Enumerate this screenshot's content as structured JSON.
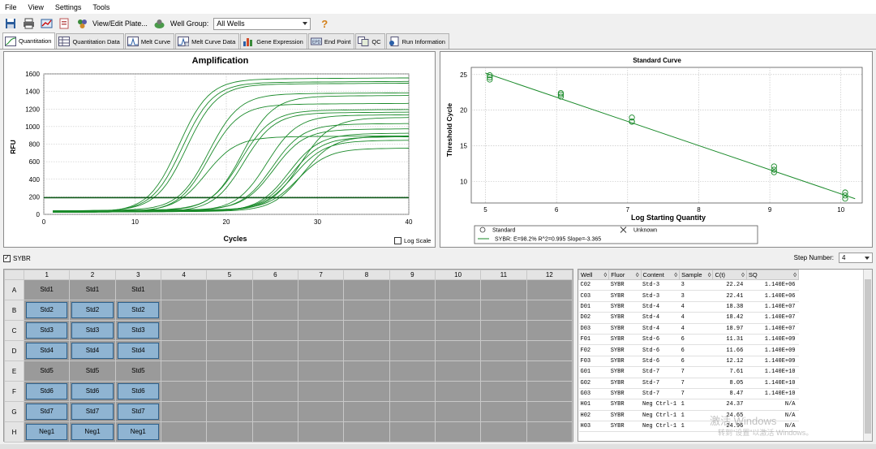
{
  "menu": [
    "File",
    "View",
    "Settings",
    "Tools"
  ],
  "toolbar": {
    "view_edit_plate": "View/Edit Plate...",
    "well_group_label": "Well Group:",
    "well_group_value": "All Wells",
    "help_icon": "help-icon"
  },
  "tabs": [
    "Quantitation",
    "Quantitation Data",
    "Melt Curve",
    "Melt Curve Data",
    "Gene Expression",
    "End Point",
    "QC",
    "Run Information"
  ],
  "amplification": {
    "title": "Amplification",
    "xlabel": "Cycles",
    "ylabel": "RFU",
    "log_scale_label": "Log Scale"
  },
  "standard_curve": {
    "title": "Standard Curve",
    "xlabel": "Log Starting Quantity",
    "ylabel": "Threshold Cycle",
    "legend_standard": "Standard",
    "legend_unknown": "Unknown",
    "legend_fit": "SYBR: E=98.2% R^2=0.995 Slope=-3.365"
  },
  "fluor_checkbox": "SYBR",
  "step_number": {
    "label": "Step Number:",
    "value": "4"
  },
  "plate": {
    "columns": [
      "1",
      "2",
      "3",
      "4",
      "5",
      "6",
      "7",
      "8",
      "9",
      "10",
      "11",
      "12"
    ],
    "rows": [
      {
        "row": "A",
        "wells": [
          "Std1",
          "Std1",
          "Std1"
        ],
        "selected": false
      },
      {
        "row": "B",
        "wells": [
          "Std2",
          "Std2",
          "Std2"
        ],
        "selected": true
      },
      {
        "row": "C",
        "wells": [
          "Std3",
          "Std3",
          "Std3"
        ],
        "selected": true
      },
      {
        "row": "D",
        "wells": [
          "Std4",
          "Std4",
          "Std4"
        ],
        "selected": true
      },
      {
        "row": "E",
        "wells": [
          "Std5",
          "Std5",
          "Std5"
        ],
        "selected": false
      },
      {
        "row": "F",
        "wells": [
          "Std6",
          "Std6",
          "Std6"
        ],
        "selected": true
      },
      {
        "row": "G",
        "wells": [
          "Std7",
          "Std7",
          "Std7"
        ],
        "selected": true
      },
      {
        "row": "H",
        "wells": [
          "Neg1",
          "Neg1",
          "Neg1"
        ],
        "selected": true
      }
    ]
  },
  "data_table": {
    "headers": [
      "Well",
      "Fluor",
      "Content",
      "Sample",
      "C(t)",
      "SQ"
    ],
    "rows": [
      [
        "C02",
        "SYBR",
        "Std-3",
        "3",
        "22.24",
        "1.140E+06"
      ],
      [
        "C03",
        "SYBR",
        "Std-3",
        "3",
        "22.41",
        "1.140E+06"
      ],
      [
        "D01",
        "SYBR",
        "Std-4",
        "4",
        "18.38",
        "1.140E+07"
      ],
      [
        "D02",
        "SYBR",
        "Std-4",
        "4",
        "18.42",
        "1.140E+07"
      ],
      [
        "D03",
        "SYBR",
        "Std-4",
        "4",
        "18.97",
        "1.140E+07"
      ],
      [
        "F01",
        "SYBR",
        "Std-6",
        "6",
        "11.31",
        "1.140E+09"
      ],
      [
        "F02",
        "SYBR",
        "Std-6",
        "6",
        "11.66",
        "1.140E+09"
      ],
      [
        "F03",
        "SYBR",
        "Std-6",
        "6",
        "12.12",
        "1.140E+09"
      ],
      [
        "G01",
        "SYBR",
        "Std-7",
        "7",
        "7.61",
        "1.140E+10"
      ],
      [
        "G02",
        "SYBR",
        "Std-7",
        "7",
        "8.05",
        "1.140E+10"
      ],
      [
        "G03",
        "SYBR",
        "Std-7",
        "7",
        "8.47",
        "1.140E+10"
      ],
      [
        "H01",
        "SYBR",
        "Neg Ctrl-1",
        "1",
        "24.37",
        "N/A"
      ],
      [
        "H02",
        "SYBR",
        "Neg Ctrl-1",
        "1",
        "24.65",
        "N/A"
      ],
      [
        "H03",
        "SYBR",
        "Neg Ctrl-1",
        "1",
        "24.96",
        "N/A"
      ]
    ]
  },
  "watermark": {
    "line1": "激活 Windows",
    "line2": "转到\"设置\"以激活 Windows。"
  },
  "chart_data": [
    {
      "type": "line",
      "title": "Amplification",
      "xlabel": "Cycles",
      "ylabel": "RFU",
      "xlim": [
        0,
        40
      ],
      "ylim": [
        0,
        1600
      ],
      "xticks": [
        0,
        10,
        20,
        30,
        40
      ],
      "yticks": [
        0,
        200,
        400,
        600,
        800,
        1000,
        1200,
        1400,
        1600
      ],
      "threshold": 190,
      "grid": true,
      "line_color": "#1a8a2a",
      "series": [
        {
          "ct": 11.3,
          "plateau": 1530
        },
        {
          "ct": 11.7,
          "plateau": 1490
        },
        {
          "ct": 12.1,
          "plateau": 1470
        },
        {
          "ct": 14.6,
          "plateau": 1360
        },
        {
          "ct": 15.0,
          "plateau": 1240
        },
        {
          "ct": 15.3,
          "plateau": 870
        },
        {
          "ct": 18.4,
          "plateau": 1330
        },
        {
          "ct": 18.4,
          "plateau": 1170
        },
        {
          "ct": 19.0,
          "plateau": 1140
        },
        {
          "ct": 21.5,
          "plateau": 1110
        },
        {
          "ct": 22.2,
          "plateau": 1010
        },
        {
          "ct": 22.4,
          "plateau": 950
        },
        {
          "ct": 24.4,
          "plateau": 900
        },
        {
          "ct": 24.7,
          "plateau": 860
        },
        {
          "ct": 25.0,
          "plateau": 820
        },
        {
          "ct": 25.6,
          "plateau": 730
        },
        {
          "ct": 26.0,
          "plateau": 870
        },
        {
          "ct": 25.2,
          "plateau": 1080
        }
      ]
    },
    {
      "type": "scatter",
      "title": "Standard Curve",
      "xlabel": "Log Starting Quantity",
      "ylabel": "Threshold Cycle",
      "xlim": [
        4.8,
        10.3
      ],
      "ylim": [
        7,
        26
      ],
      "xticks": [
        5,
        6,
        7,
        8,
        9,
        10
      ],
      "yticks": [
        10,
        15,
        20,
        25
      ],
      "grid": true,
      "points": [
        {
          "x": 5.06,
          "y": 24.9
        },
        {
          "x": 5.06,
          "y": 24.6
        },
        {
          "x": 5.06,
          "y": 24.3
        },
        {
          "x": 6.06,
          "y": 22.4
        },
        {
          "x": 6.06,
          "y": 22.2
        },
        {
          "x": 6.06,
          "y": 21.9
        },
        {
          "x": 7.06,
          "y": 18.97
        },
        {
          "x": 7.06,
          "y": 18.42
        },
        {
          "x": 7.06,
          "y": 18.38
        },
        {
          "x": 9.06,
          "y": 12.12
        },
        {
          "x": 9.06,
          "y": 11.66
        },
        {
          "x": 9.06,
          "y": 11.31
        },
        {
          "x": 10.06,
          "y": 8.47
        },
        {
          "x": 10.06,
          "y": 8.05
        },
        {
          "x": 10.06,
          "y": 7.61
        }
      ],
      "fit": {
        "x": [
          5.0,
          10.2
        ],
        "y": [
          25.2,
          7.6
        ]
      }
    }
  ]
}
